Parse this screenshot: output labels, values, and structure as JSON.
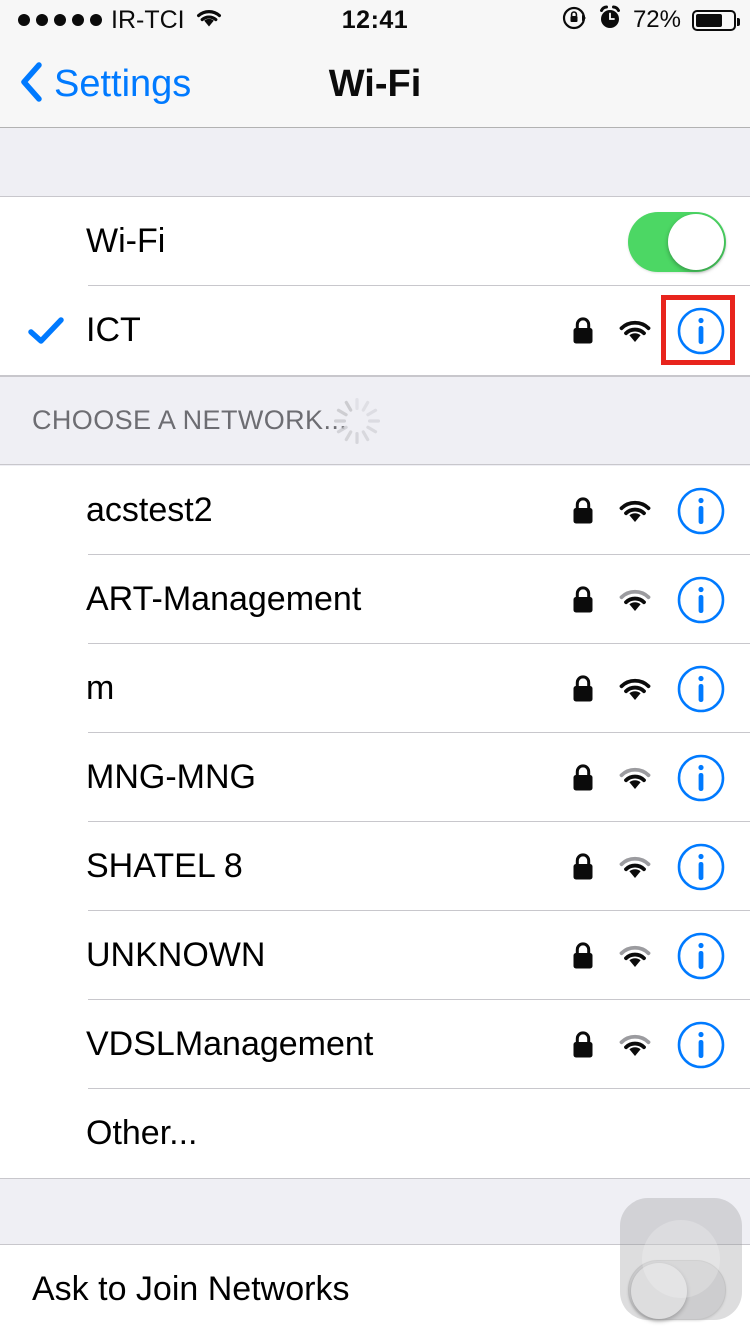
{
  "status_bar": {
    "signal_dots": 5,
    "carrier": "IR-TCI",
    "wifi_icon": "wifi-icon",
    "time": "12:41",
    "rotation_lock_icon": "rotation-lock-icon",
    "alarm_icon": "alarm-clock-icon",
    "battery_percent": "72%",
    "battery_level": 72
  },
  "nav_bar": {
    "back_label": "Settings",
    "back_icon": "chevron-left-icon",
    "title": "Wi-Fi"
  },
  "wifi_toggle": {
    "label": "Wi-Fi",
    "state": "on"
  },
  "connected_network": {
    "name": "ICT",
    "checked": true,
    "secured": true,
    "signal_bars": 3,
    "info_label": "i",
    "highlighted": true
  },
  "section_header": {
    "title": "CHOOSE A NETWORK...",
    "loading": true,
    "spinner_icon": "activity-spinner-icon"
  },
  "networks": [
    {
      "name": "acstest2",
      "secured": true,
      "signal_bars": 3
    },
    {
      "name": "ART-Management",
      "secured": true,
      "signal_bars": 2
    },
    {
      "name": "m",
      "secured": true,
      "signal_bars": 3
    },
    {
      "name": "MNG-MNG",
      "secured": true,
      "signal_bars": 2
    },
    {
      "name": "SHATEL 8",
      "secured": true,
      "signal_bars": 2
    },
    {
      "name": "UNKNOWN",
      "secured": true,
      "signal_bars": 2
    },
    {
      "name": "VDSLManagement",
      "secured": true,
      "signal_bars": 2
    }
  ],
  "other_row": {
    "label": "Other..."
  },
  "ask_to_join": {
    "label": "Ask to Join Networks",
    "state": "off"
  },
  "overlay": {
    "assistive_touch_icon": "assistive-touch-icon"
  },
  "colors": {
    "accent_blue": "#007AFF",
    "toggle_green": "#4CD764",
    "highlight_red": "#E8241D",
    "group_background": "#EFEFF4",
    "separator": "#C8C7CC",
    "header_text": "#6D6D72"
  }
}
